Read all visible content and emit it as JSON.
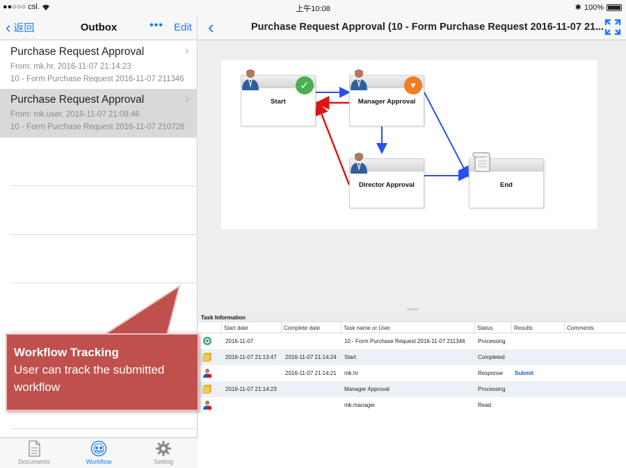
{
  "status_bar": {
    "carrier": "●●○○○ csl.",
    "wifi_icon": "wifi-icon",
    "time": "上午10:08",
    "bluetooth": "✱",
    "battery": "100%"
  },
  "left_nav": {
    "back_label": "返回",
    "title": "Outbox",
    "more_label": "•••",
    "edit_label": "Edit"
  },
  "messages": [
    {
      "title": "Purchase Request Approval",
      "from": "From: mk.hr, 2016-11-07 21:14:23",
      "subject": "10 - Form Purchase Request 2016-11-07 211346"
    },
    {
      "title": "Purchase Request Approval",
      "from": "From: mk.user, 2016-11-07 21:08:46",
      "subject": "10 - Form Purchase Request 2016-11-07 210726"
    }
  ],
  "tabs": [
    {
      "label": "Documents",
      "icon": "document-icon"
    },
    {
      "label": "Workflow",
      "icon": "workflow-icon"
    },
    {
      "label": "Setting",
      "icon": "gear-icon"
    }
  ],
  "callout": {
    "heading": "Workflow Tracking",
    "body": "User can track the submitted workflow",
    "color": "#c0504d"
  },
  "right_nav": {
    "title": "Purchase Request Approval (10 - Form Purchase Request 2016-11-07 21..."
  },
  "workflow": {
    "nodes": [
      {
        "label": "Start",
        "status": "completed"
      },
      {
        "label": "Manager Approval",
        "status": "processing"
      },
      {
        "label": "Director Approval",
        "status": "pending"
      },
      {
        "label": "End",
        "status": "pending"
      }
    ],
    "colors": {
      "forward": "#2a4ff0",
      "reject": "#e01414",
      "completed": "#4caf50",
      "processing": "#f07d22"
    }
  },
  "task_info": {
    "caption": "Task Information",
    "columns": [
      "Start date",
      "Complete date",
      "Task name or User",
      "Status",
      "Results",
      "Comments"
    ],
    "rows": [
      {
        "icon": "workflow-circle-icon",
        "start": "2016-11-07",
        "complete": "",
        "task": "10 - Form Purchase Request 2016-11-07 211346",
        "status": "Processing",
        "result": ""
      },
      {
        "icon": "task-folder-icon",
        "start": "2016-11-07 21:13:47",
        "complete": "2016-11-07 21:14:24",
        "task": "Start",
        "status": "Completed",
        "result": ""
      },
      {
        "icon": "user-icon",
        "start": "",
        "complete": "2016-11-07 21:14:21",
        "task": "mk.hr",
        "status": "Response",
        "result": "Submit"
      },
      {
        "icon": "task-folder-icon",
        "start": "2016-11-07 21:14:23",
        "complete": "",
        "task": "Manager Approval",
        "status": "Processing",
        "result": ""
      },
      {
        "icon": "user-icon",
        "start": "",
        "complete": "",
        "task": "mk.manager",
        "status": "Read",
        "result": ""
      }
    ]
  }
}
